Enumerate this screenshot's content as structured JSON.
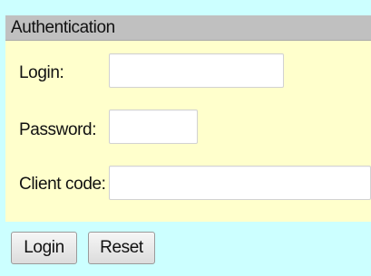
{
  "panel": {
    "title": "Authentication"
  },
  "fields": {
    "login": {
      "label": "Login:",
      "value": "",
      "placeholder": ""
    },
    "password": {
      "label": "Password:",
      "value": "",
      "placeholder": ""
    },
    "client_code": {
      "label": "Client code:",
      "value": "",
      "placeholder": ""
    }
  },
  "buttons": {
    "login_label": "Login",
    "reset_label": "Reset"
  },
  "colors": {
    "page_background": "#ccffff",
    "panel_background": "#ffffcc",
    "header_background": "#c0c0c0"
  }
}
